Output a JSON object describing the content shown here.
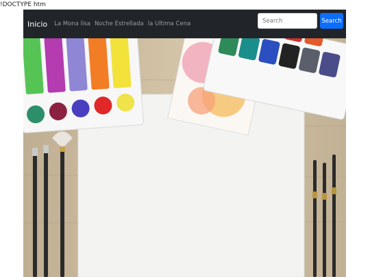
{
  "page": {
    "stray_text": "!DOCTYPE htm"
  },
  "navbar": {
    "brand": "Inicio",
    "links": [
      "La Mona lisa",
      "Noche Estrellada",
      "la Ultima Cena"
    ],
    "search": {
      "placeholder": "Search",
      "button_label": "Search"
    }
  },
  "colors": {
    "navbar_bg": "#212529",
    "search_button": "#0d6efd",
    "wood_background": "#c9b89c",
    "paper": "#f2f2f0"
  },
  "hero": {
    "image_alt": "Watercolor palettes, paint-stained paper, blank canvas and paintbrushes on a wooden table"
  }
}
